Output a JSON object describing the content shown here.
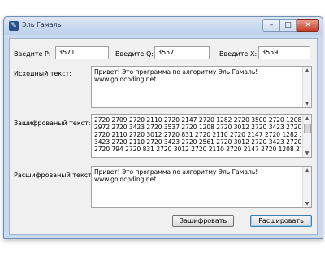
{
  "window": {
    "title": "Эль Гамаль"
  },
  "controls": {
    "minimize": "–",
    "maximize": "□",
    "close": "✕"
  },
  "params": {
    "p_label": "Введите P:",
    "p_value": "3571",
    "q_label": "Введите Q:",
    "q_value": "3557",
    "x_label": "Введите X:",
    "x_value": "3559"
  },
  "source": {
    "label": "Исходный текст:",
    "lines": [
      "Привет! Это программа по алгоритму Эль Гамаль!",
      "www.goldcoding.net"
    ]
  },
  "encrypted": {
    "label": "Зашифрованый текст:",
    "lines": [
      "2720 2709 2720 2110 2720 2147 2720 1282 2720 3500 2720 1208 2720",
      "2972 2720 3423 2720 3537 2720 1208 2720 3012 2720 3423 2720 2561",
      "2720 2110 2720 3012 2720 831 2720 2110 2720 2147 2720 1282 2720",
      "3423 2720 2110 2720 3423 2720 2561 2720 3012 2720 3423 2720 2184",
      "2720 794 2720 831 2720 3012 2720 2110 2720 2147 2720 1208 2720"
    ]
  },
  "decrypted": {
    "label": "Расшифрованый текст:",
    "lines": [
      "Привет! Это программа по алгоритму Эль Гамаль!",
      "www.goldcoding.net"
    ]
  },
  "buttons": {
    "encrypt": "Зашифровать",
    "decrypt": "Расшировать"
  }
}
